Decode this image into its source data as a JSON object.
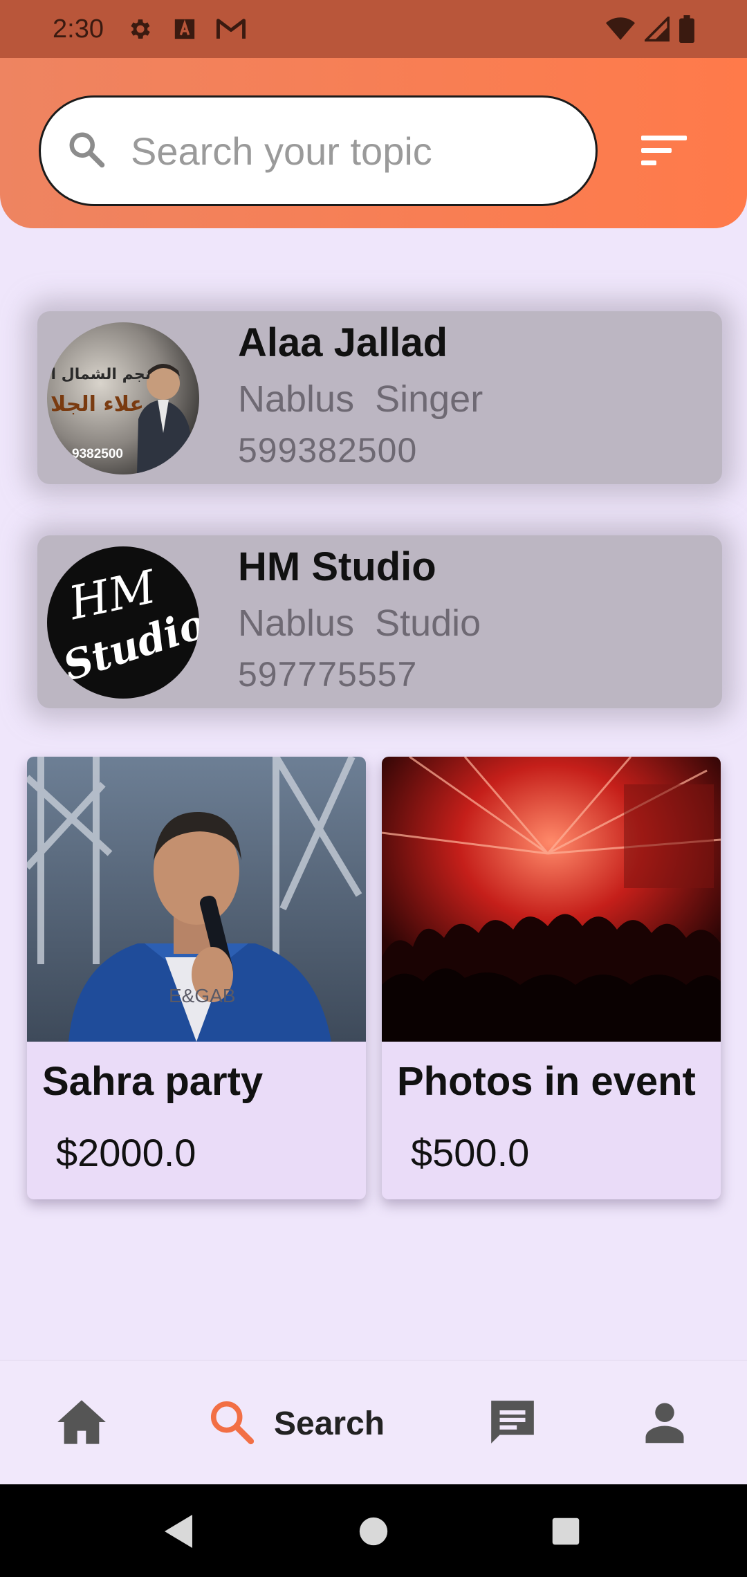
{
  "status_bar": {
    "time": "2:30",
    "left_icons": [
      "settings-icon",
      "font-a-icon",
      "gmail-icon"
    ],
    "right_icons": [
      "wifi-icon",
      "signal-icon",
      "battery-icon"
    ]
  },
  "search": {
    "placeholder": "Search your topic",
    "value": ""
  },
  "results": [
    {
      "name": "Alaa Jallad",
      "city": "Nablus",
      "category": "Singer",
      "phone": "599382500",
      "avatar_lines": [
        "نجم الشمال الفنا",
        "علاء الجلا",
        "9382500"
      ]
    },
    {
      "name": "HM Studio",
      "city": "Nablus",
      "category": "Studio",
      "phone": "597775557",
      "avatar_lines": [
        "HM",
        "Studio"
      ]
    }
  ],
  "products": [
    {
      "title": "Sahra party",
      "price": "$2000.0",
      "shirt_text": "E&GAB"
    },
    {
      "title": "Photos in event",
      "price": "$500.0"
    }
  ],
  "bottom_nav": {
    "items": [
      {
        "icon": "home-icon",
        "label": ""
      },
      {
        "icon": "search-icon",
        "label": "Search",
        "active": true
      },
      {
        "icon": "chat-icon",
        "label": ""
      },
      {
        "icon": "profile-icon",
        "label": ""
      }
    ]
  },
  "colors": {
    "header": "#ff7a4a",
    "status_bar": "#b9563a",
    "background": "#efe6fb",
    "active_icon": "#f26f45",
    "nav_icon": "#555555"
  }
}
